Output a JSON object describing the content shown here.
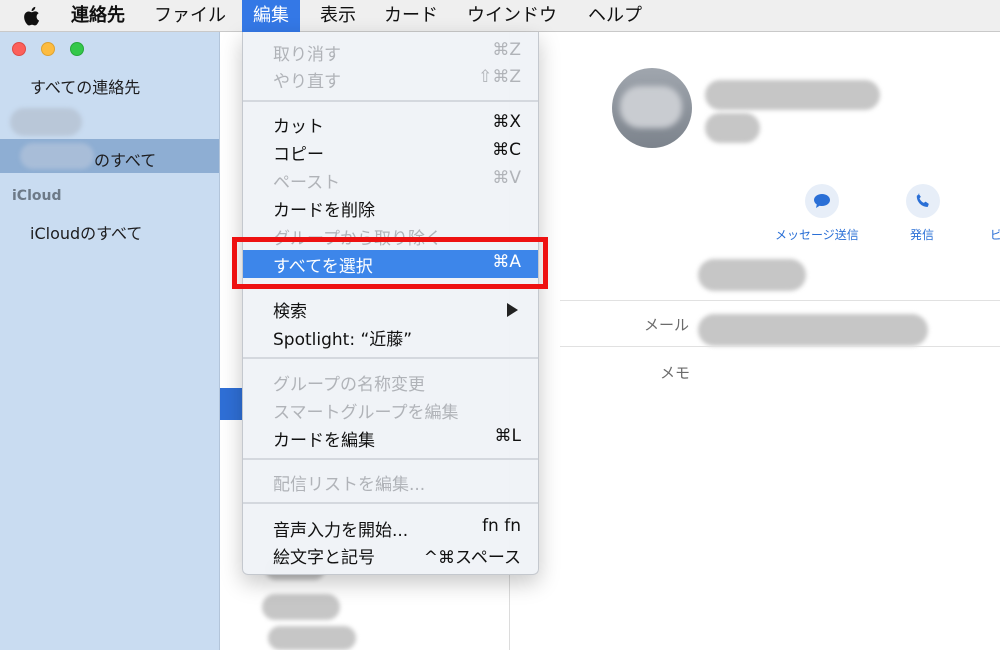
{
  "menubar": {
    "app_name": "連絡先",
    "items": [
      "ファイル",
      "編集",
      "表示",
      "カード",
      "ウインドウ",
      "ヘルプ"
    ],
    "active_item": "編集"
  },
  "sidebar": {
    "all_contacts": "すべての連絡先",
    "selected_suffix": "のすべて",
    "icloud_header": "iCloud",
    "icloud_all": "iCloudのすべて"
  },
  "detail": {
    "actions": [
      {
        "label": "メッセージ送信",
        "icon": "message-bubble-icon"
      },
      {
        "label": "発信",
        "icon": "phone-icon"
      },
      {
        "label": "ビ",
        "icon": "video-icon"
      }
    ],
    "fields": [
      {
        "label": "メール"
      },
      {
        "label": "メモ"
      }
    ]
  },
  "edit_menu": {
    "groups": [
      [
        {
          "label": "取り消す",
          "shortcut": "⌘Z",
          "enabled": false
        },
        {
          "label": "やり直す",
          "shortcut": "⇧⌘Z",
          "enabled": false
        }
      ],
      [
        {
          "label": "カット",
          "shortcut": "⌘X",
          "enabled": true
        },
        {
          "label": "コピー",
          "shortcut": "⌘C",
          "enabled": true
        },
        {
          "label": "ペースト",
          "shortcut": "⌘V",
          "enabled": false
        },
        {
          "label": "カードを削除",
          "shortcut": "",
          "enabled": true
        },
        {
          "label": "グループから取り除く",
          "shortcut": "",
          "enabled": false
        },
        {
          "label": "すべてを選択",
          "shortcut": "⌘A",
          "enabled": true,
          "selected": true
        }
      ],
      [
        {
          "label": "検索",
          "shortcut": "",
          "enabled": true,
          "submenu": true
        },
        {
          "label": "Spotlight: “近藤”",
          "shortcut": "",
          "enabled": true
        }
      ],
      [
        {
          "label": "グループの名称変更",
          "shortcut": "",
          "enabled": false
        },
        {
          "label": "スマートグループを編集",
          "shortcut": "",
          "enabled": false
        },
        {
          "label": "カードを編集",
          "shortcut": "⌘L",
          "enabled": true
        }
      ],
      [
        {
          "label": "配信リストを編集...",
          "shortcut": "",
          "enabled": false
        }
      ],
      [
        {
          "label": "音声入力を開始...",
          "shortcut": "fn fn",
          "enabled": true
        },
        {
          "label": "絵文字と記号",
          "shortcut": "^⌘スペース",
          "enabled": true
        }
      ]
    ]
  },
  "colors": {
    "menu_selected": "#3d86ea",
    "annotation_box": "#ee1111",
    "sidebar_bg": "#c9dcf1"
  }
}
